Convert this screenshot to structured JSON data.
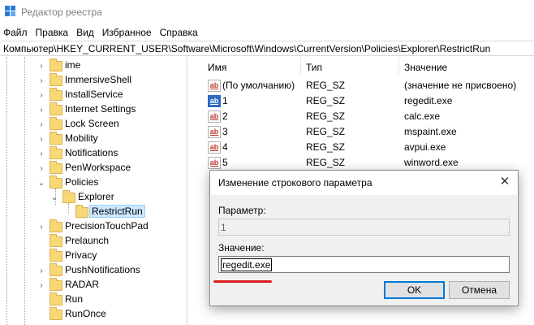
{
  "window": {
    "title": "Редактор реестра",
    "icon": "registry-editor-icon"
  },
  "menu": [
    "Файл",
    "Правка",
    "Вид",
    "Избранное",
    "Справка"
  ],
  "address": "Компьютер\\HKEY_CURRENT_USER\\Software\\Microsoft\\Windows\\CurrentVersion\\Policies\\Explorer\\RestrictRun",
  "tree": [
    {
      "label": "ime",
      "expander": "›"
    },
    {
      "label": "ImmersiveShell",
      "expander": "›"
    },
    {
      "label": "InstallService",
      "expander": "›"
    },
    {
      "label": "Internet Settings",
      "expander": "›"
    },
    {
      "label": "Lock Screen",
      "expander": "›"
    },
    {
      "label": "Mobility",
      "expander": "›"
    },
    {
      "label": "Notifications",
      "expander": "›"
    },
    {
      "label": "PenWorkspace",
      "expander": "›"
    },
    {
      "label": "Policies",
      "expander": "⌄"
    },
    {
      "label": "Explorer",
      "expander": "⌄"
    },
    {
      "label": "RestrictRun",
      "expander": "",
      "selected": true
    },
    {
      "label": "PrecisionTouchPad",
      "expander": "›"
    },
    {
      "label": "Prelaunch",
      "expander": ""
    },
    {
      "label": "Privacy",
      "expander": ""
    },
    {
      "label": "PushNotifications",
      "expander": "›"
    },
    {
      "label": "RADAR",
      "expander": "›"
    },
    {
      "label": "Run",
      "expander": ""
    },
    {
      "label": "RunOnce",
      "expander": ""
    }
  ],
  "list": {
    "columns": {
      "name": "Имя",
      "type": "Тип",
      "value": "Значение"
    },
    "rows": [
      {
        "name": "(По умолчанию)",
        "type": "REG_SZ",
        "value": "(значение не присвоено)"
      },
      {
        "name": "1",
        "type": "REG_SZ",
        "value": "regedit.exe"
      },
      {
        "name": "2",
        "type": "REG_SZ",
        "value": "calc.exe"
      },
      {
        "name": "3",
        "type": "REG_SZ",
        "value": "mspaint.exe"
      },
      {
        "name": "4",
        "type": "REG_SZ",
        "value": "avpui.exe"
      },
      {
        "name": "5",
        "type": "REG_SZ",
        "value": "winword.exe"
      }
    ]
  },
  "dialog": {
    "title": "Изменение строкового параметра",
    "param_label": "Параметр:",
    "param_value": "1",
    "value_label": "Значение:",
    "value_text": "regedit.exe",
    "ok_label": "OK",
    "cancel_label": "Отмена",
    "close_glyph": "✕"
  }
}
